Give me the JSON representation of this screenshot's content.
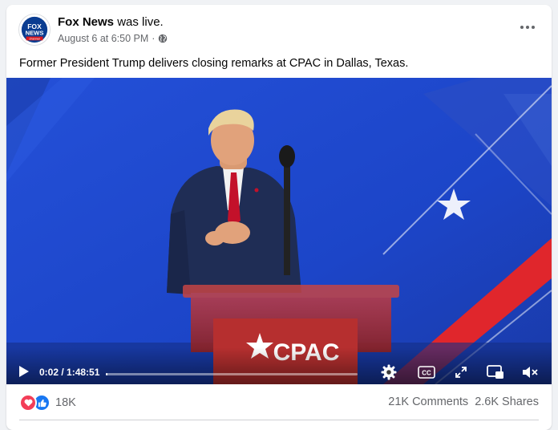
{
  "post": {
    "page_name": "Fox News",
    "status_text": "was live.",
    "timestamp": "August 6 at 6:50 PM",
    "separator": "·",
    "caption": "Former President Trump delivers closing remarks at CPAC in Dallas, Texas.",
    "avatar_logo_text": [
      "FOX",
      "NEWS",
      "channel"
    ]
  },
  "video": {
    "stage_sign": "CPAC",
    "time_display": "0:02 / 1:48:51",
    "progress": 0.0003,
    "controls": [
      "play-icon",
      "settings-icon",
      "captions-icon",
      "fullscreen-icon",
      "picture-in-picture-icon",
      "mute-icon"
    ],
    "captions_label": "CC"
  },
  "engagement": {
    "reaction_icons": [
      "love-icon",
      "like-icon"
    ],
    "reaction_count": "18K",
    "comments": "21K Comments",
    "shares": "2.6K Shares"
  },
  "colors": {
    "facebook_blue": "#1877f2",
    "love_red": "#f33e58",
    "stage_blue": "#1f4fd6",
    "stage_red": "#e0262c",
    "secondary_text": "#65676b"
  }
}
